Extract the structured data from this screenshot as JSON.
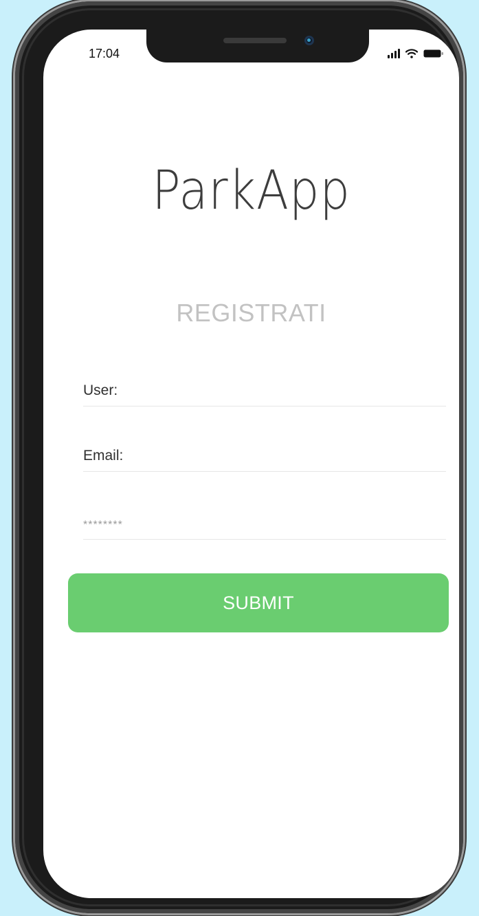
{
  "status_bar": {
    "time": "17:04",
    "icons": [
      "signal-icon",
      "wifi-icon",
      "battery-icon"
    ]
  },
  "app": {
    "logo": "ParkApp",
    "title": "REGISTRATI"
  },
  "form": {
    "user_placeholder": "User:",
    "email_placeholder": "Email:",
    "password_placeholder": "********",
    "submit_label": "SUBMIT"
  },
  "colors": {
    "background": "#c9f0fb",
    "submit": "#6acd70",
    "title": "#c2c2c2",
    "logo": "#3d3d3d"
  }
}
